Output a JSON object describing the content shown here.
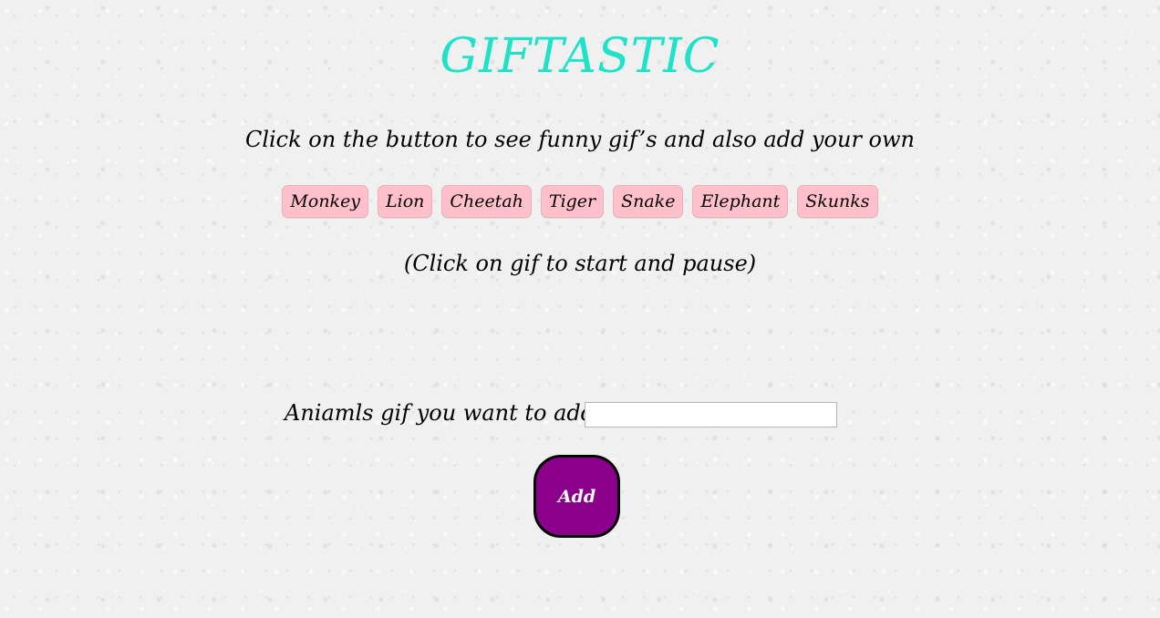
{
  "header": {
    "title": "GIFTASTIC",
    "subtitle": "Click on the button to see funny gif’s and also add your own"
  },
  "animals": {
    "buttons": [
      "Monkey",
      "Lion",
      "Cheetah",
      "Tiger",
      "Snake",
      "Elephant",
      "Skunks"
    ]
  },
  "hint": "(Click on gif to start and pause)",
  "form": {
    "label": "Aniamls gif you want to add",
    "input_value": "",
    "add_label": "Add"
  },
  "colors": {
    "title": "#1ee3c8",
    "animal_button_bg": "#ffc0cb",
    "add_button_bg": "#8b008b"
  }
}
